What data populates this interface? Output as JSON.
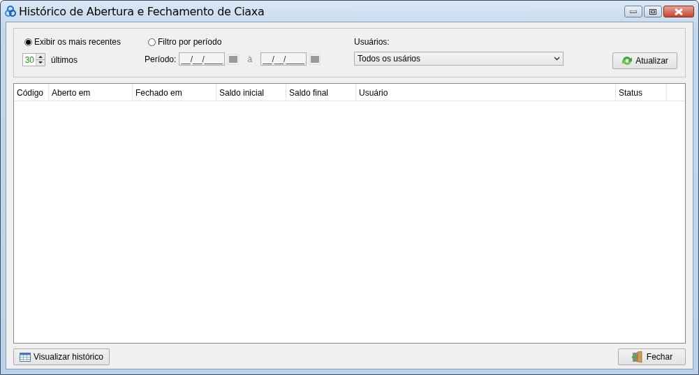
{
  "window": {
    "title": "Histórico de Abertura e Fechamento de Ciaxa"
  },
  "filter": {
    "modes": [
      {
        "label": "Exibir os mais recentes",
        "selected": true
      },
      {
        "label": "Filtro por período",
        "selected": false
      }
    ],
    "recent_count": "30",
    "recent_unit": "últimos",
    "period_label": "Período:",
    "date_from": "__/__/____",
    "date_separator": "à",
    "date_to": "__/__/____",
    "users_label": "Usuários:",
    "users_value": "Todos os usários",
    "refresh_button": "Atualizar"
  },
  "table": {
    "columns": [
      "Código",
      "Aberto em",
      "Fechado em",
      "Saldo inicial",
      "Saldo final",
      "Usuário",
      "Status"
    ]
  },
  "buttons": {
    "history": "Visualizar histórico",
    "close": "Fechar"
  }
}
